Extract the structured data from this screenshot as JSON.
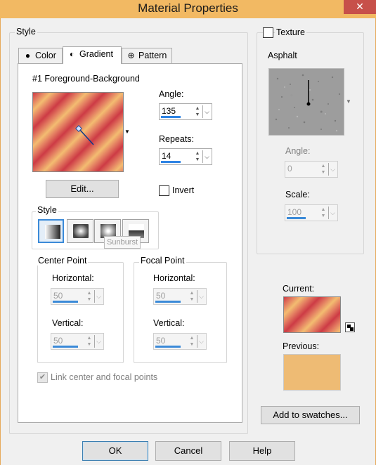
{
  "window": {
    "title": "Material Properties",
    "close_glyph": "✕"
  },
  "style_group": {
    "legend": "Style"
  },
  "tabs": [
    {
      "label": "Color",
      "icon": "filled-circle-icon"
    },
    {
      "label": "Gradient",
      "icon": "half-circle-icon"
    },
    {
      "label": "Pattern",
      "icon": "pattern-icon"
    }
  ],
  "gradient": {
    "name": "#1 Foreground-Background",
    "angle_label": "Angle:",
    "angle_value": "135",
    "repeats_label": "Repeats:",
    "repeats_value": "14",
    "edit_button": "Edit...",
    "invert_label": "Invert",
    "style_label": "Style",
    "tooltip": "Sunburst",
    "center_point": {
      "legend": "Center Point",
      "horizontal_label": "Horizontal:",
      "horizontal_value": "50",
      "vertical_label": "Vertical:",
      "vertical_value": "50"
    },
    "focal_point": {
      "legend": "Focal Point",
      "horizontal_label": "Horizontal:",
      "horizontal_value": "50",
      "vertical_label": "Vertical:",
      "vertical_value": "50"
    },
    "link_label": "Link center and focal points",
    "colors": {
      "red": "#cd3b45",
      "coral": "#e27a60",
      "peach": "#f3bc71"
    }
  },
  "texture": {
    "checkbox_label": "Texture",
    "name": "Asphalt",
    "angle_label": "Angle:",
    "angle_value": "0",
    "scale_label": "Scale:",
    "scale_value": "100"
  },
  "preview": {
    "current_label": "Current:",
    "previous_label": "Previous:",
    "previous_color": "#eebb74",
    "add_swatches_button": "Add to swatches..."
  },
  "footer": {
    "ok": "OK",
    "cancel": "Cancel",
    "help": "Help"
  },
  "accent_color": "#2f84e4"
}
